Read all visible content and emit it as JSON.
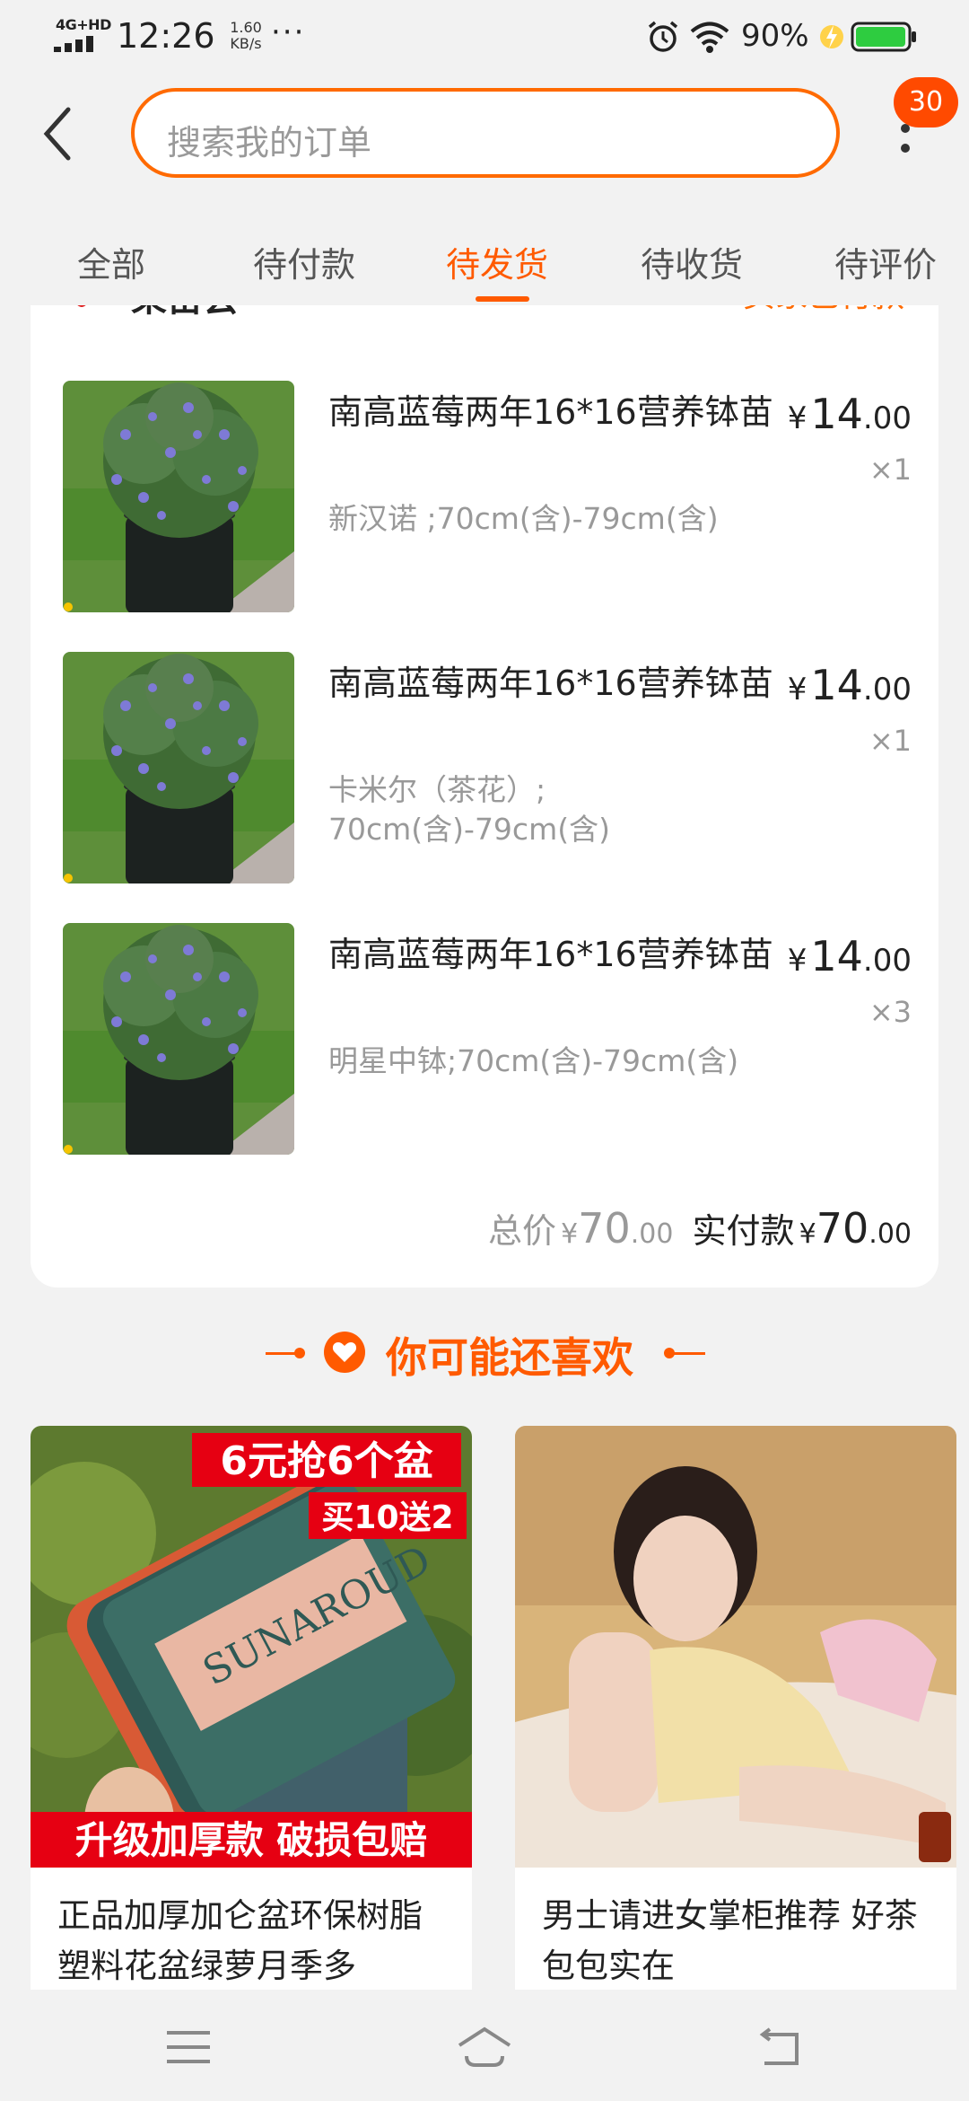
{
  "status_bar": {
    "network": "4G+HD",
    "time": "12:26",
    "speed_value": "1.60",
    "speed_unit": "KB/s",
    "more": "···",
    "battery_percent": "90%"
  },
  "header": {
    "search_placeholder": "搜索我的订单",
    "notification_count": "30"
  },
  "tabs": [
    {
      "label": "全部"
    },
    {
      "label": "待付款"
    },
    {
      "label": "待发货"
    },
    {
      "label": "待收货"
    },
    {
      "label": "待评价"
    }
  ],
  "active_tab": "待发货",
  "order": {
    "shop_name": "果苗会",
    "status": "买家已付款",
    "items": [
      {
        "title": "南高蓝莓两年16*16营养钵苗",
        "spec": "新汉诺 ;70cm(含)-79cm(含)",
        "price_currency": "¥",
        "price_int": "14",
        "price_dec": ".00",
        "qty": "×1"
      },
      {
        "title": "南高蓝莓两年16*16营养钵苗",
        "spec": "卡米尔（茶花）;\n70cm(含)-79cm(含)",
        "price_currency": "¥",
        "price_int": "14",
        "price_dec": ".00",
        "qty": "×1"
      },
      {
        "title": "南高蓝莓两年16*16营养钵苗",
        "spec": "明星中钵;70cm(含)-79cm(含)",
        "price_currency": "¥",
        "price_int": "14",
        "price_dec": ".00",
        "qty": "×3"
      }
    ],
    "total_label": "总价",
    "total_currency": "¥",
    "total_int": "70",
    "total_dec": ".00",
    "paid_label": "实付款",
    "paid_currency": "¥",
    "paid_int": "70",
    "paid_dec": ".00"
  },
  "recommend": {
    "title": "你可能还喜欢",
    "cards": [
      {
        "title": "正品加厚加仑盆环保树脂塑料花盆绿萝月季多",
        "badge_top": "6元抢6个盆",
        "badge_mid": "买10送2",
        "banner": "升级加厚款 破损包赔",
        "pot_brand": "SUNAROUD"
      },
      {
        "title": "男士请进女掌柜推荐 好茶包包实在"
      }
    ]
  },
  "colors": {
    "accent": "#ff5a00",
    "search_border": "#ff6a00",
    "badge": "#ff4a00"
  }
}
